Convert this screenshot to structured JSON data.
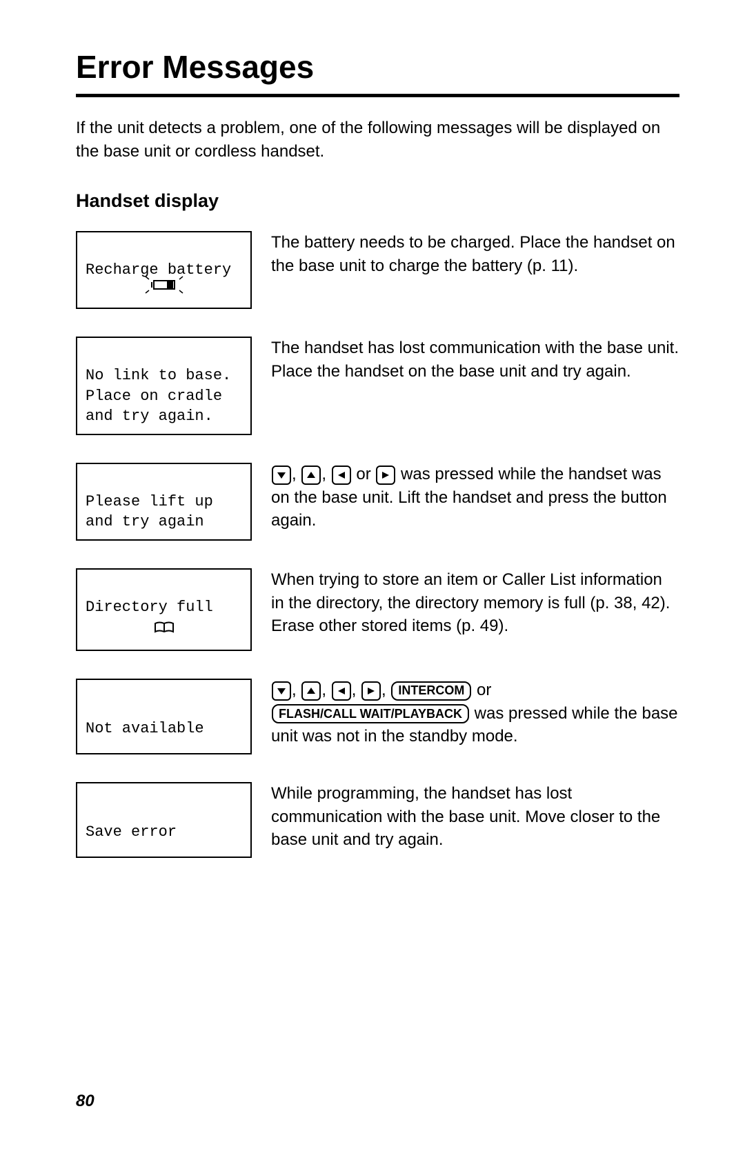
{
  "page": {
    "title": "Error Messages",
    "intro": "If the unit detects a problem, one of the following messages will be displayed on the base unit or cordless handset.",
    "subheading": "Handset display",
    "page_number": "80"
  },
  "rows": [
    {
      "display": "Recharge battery",
      "explanation": "The battery needs to be charged. Place the handset on the base unit to charge the battery (p. 11).",
      "icon": "battery-charging"
    },
    {
      "display": "No link to base.\nPlace on cradle\nand try again.",
      "explanation": "The handset has lost communication with the base unit. Place the handset on the base unit and try again."
    },
    {
      "display": "Please lift up\nand try again",
      "explanation_parts": {
        "after_keys": " was pressed while the handset was on the base unit. Lift the handset and press the button again.",
        "sep_or": " or "
      }
    },
    {
      "display": "Directory full",
      "explanation": "When trying to store an item or Caller List information in the directory, the directory memory is full (p. 38, 42). Erase other stored items (p. 49).",
      "icon": "open-book"
    },
    {
      "display": "Not available",
      "explanation_parts": {
        "intercom_label": "INTERCOM",
        "flash_label": "FLASH/CALL WAIT/PLAYBACK",
        "sep_or": " or ",
        "tail": " was pressed while the base unit was not in the standby mode."
      }
    },
    {
      "display": "Save error",
      "explanation": "While programming, the handset has lost communication with the base unit. Move closer to the base unit and try again."
    }
  ]
}
